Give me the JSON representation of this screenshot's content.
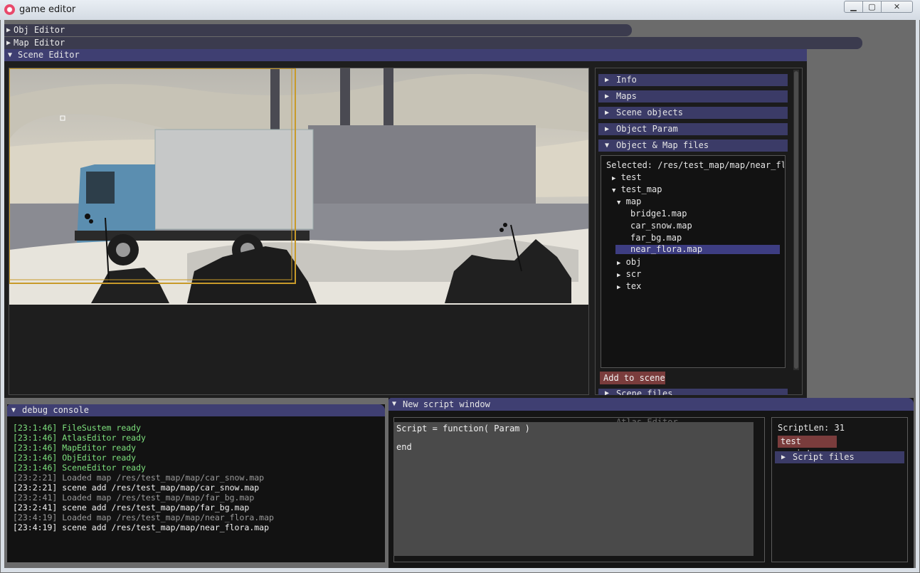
{
  "window": {
    "title": "game editor",
    "min": "▁",
    "max": "▢",
    "close": "✕"
  },
  "headers": {
    "obj_editor": "Obj Editor",
    "map_editor": "Map Editor",
    "scene_editor": "Scene Editor"
  },
  "scene_panel": {
    "sections": [
      "Info",
      "Maps",
      "Scene objects",
      "Object Param",
      "Object & Map files"
    ],
    "selected": "Selected: /res/test_map/map/near_fl ",
    "tree": [
      {
        "label": "test",
        "arrow": "▶"
      },
      {
        "label": "test_map",
        "arrow": "▼"
      },
      {
        "label": "map",
        "arrow": "▼"
      },
      {
        "label": "bridge1.map",
        "arrow": ""
      },
      {
        "label": "car_snow.map",
        "arrow": ""
      },
      {
        "label": "far_bg.map",
        "arrow": ""
      },
      {
        "label": "near_flora.map",
        "arrow": ""
      },
      {
        "label": "obj",
        "arrow": "▶"
      },
      {
        "label": "scr",
        "arrow": "▶"
      },
      {
        "label": "tex",
        "arrow": "▶"
      }
    ],
    "add_button": "Add to scene",
    "next_section": "Scene files"
  },
  "debug": {
    "title": "debug console",
    "lines": [
      {
        "text": "[23:1:46] FileSustem ready",
        "color": "#7de07d"
      },
      {
        "text": "[23:1:46] AtlasEditor ready",
        "color": "#7de07d"
      },
      {
        "text": "[23:1:46] MapEditor ready",
        "color": "#7de07d"
      },
      {
        "text": "[23:1:46] ObjEditor ready",
        "color": "#7de07d"
      },
      {
        "text": "[23:1:46] SceneEditor ready",
        "color": "#7de07d"
      },
      {
        "text": "[23:2:21] Loaded map /res/test_map/map/car_snow.map",
        "color": "#9a9a9a"
      },
      {
        "text": "[23:2:21] scene add /res/test_map/map/car_snow.map",
        "color": "#f0f0f0"
      },
      {
        "text": "[23:2:41] Loaded map /res/test_map/map/far_bg.map",
        "color": "#9a9a9a"
      },
      {
        "text": "[23:2:41] scene add /res/test_map/map/far_bg.map",
        "color": "#f0f0f0"
      },
      {
        "text": "[23:4:19] Loaded map /res/test_map/map/near_flora.map",
        "color": "#9a9a9a"
      },
      {
        "text": "[23:4:19] scene add /res/test_map/map/near_flora.map",
        "color": "#f0f0f0"
      }
    ]
  },
  "script": {
    "title": "New script window",
    "line1": "Script = function( Param )",
    "line2": "end",
    "len": "ScriptLen: 31",
    "test_button": "test script",
    "files": "Script files",
    "atlas_ghost": "Atlas Editor"
  }
}
